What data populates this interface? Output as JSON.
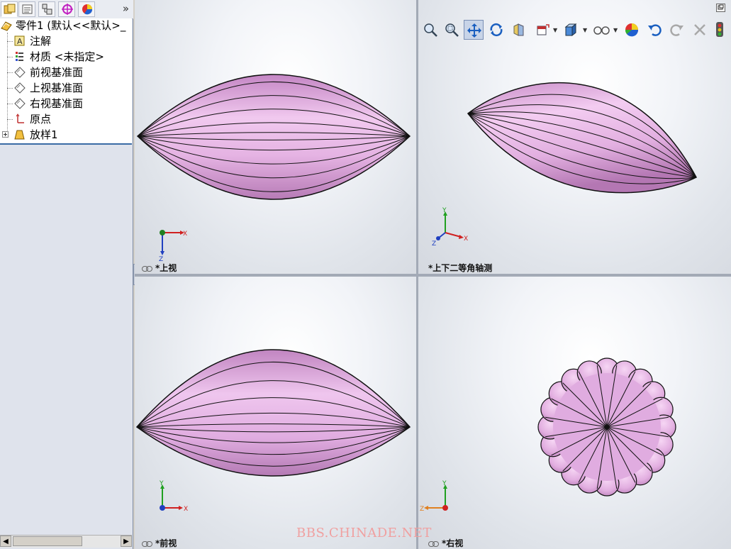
{
  "left_panel": {
    "tabs": [
      {
        "name": "FeatureManager"
      },
      {
        "name": "PropertyManager"
      },
      {
        "name": "ConfigurationManager"
      },
      {
        "name": "DimXpertManager"
      },
      {
        "name": "DisplayManager"
      }
    ],
    "expand_label": "»",
    "tree": {
      "root": "零件1  (默认<<默认>_",
      "items": [
        {
          "label": "注解",
          "icon": "annotations-icon"
        },
        {
          "label": "材质 <未指定>",
          "icon": "material-icon"
        },
        {
          "label": "前视基准面",
          "icon": "plane-icon"
        },
        {
          "label": "上视基准面",
          "icon": "plane-icon"
        },
        {
          "label": "右视基准面",
          "icon": "plane-icon"
        },
        {
          "label": "原点",
          "icon": "origin-icon"
        },
        {
          "label": "放样1",
          "icon": "loft-icon"
        }
      ]
    }
  },
  "viewports": {
    "top": {
      "label": "*上视",
      "axes": [
        "X",
        "Z"
      ]
    },
    "iso": {
      "label": "*上下二等角轴测",
      "axes": [
        "Y",
        "X",
        "Z"
      ]
    },
    "front": {
      "label": "*前视",
      "axes": [
        "Y",
        "X"
      ]
    },
    "right": {
      "label": "*右视",
      "axes": [
        "Y",
        "Z"
      ]
    }
  },
  "toolbar": {
    "buttons": [
      "zoom-to-fit",
      "zoom-to-area",
      "pan",
      "rotate",
      "section-view",
      "view-orientation",
      "display-style",
      "hide-show",
      "appearance",
      "undo-view",
      "redo-view",
      "close",
      "render-tools"
    ]
  },
  "colors": {
    "shape_fill": "#e7b6e6",
    "shape_shade": "#c98fc8",
    "edge": "#111111",
    "viewport_bg": "#e9ecf1"
  },
  "watermark": "BBS.CHINADE.NET"
}
